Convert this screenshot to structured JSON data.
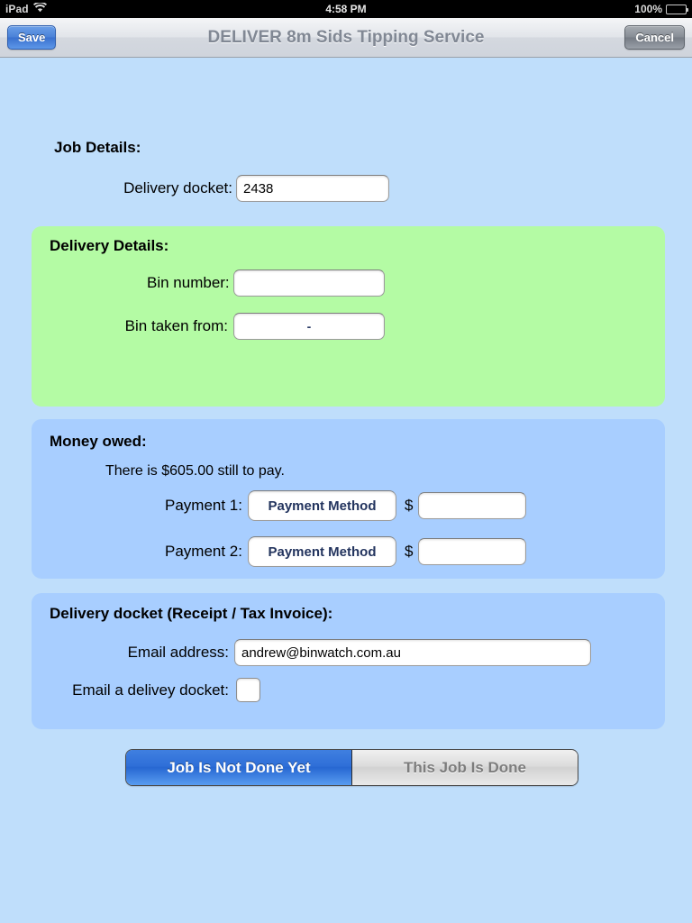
{
  "status_bar": {
    "device": "iPad",
    "wifi_icon": "wifi-icon",
    "time": "4:58 PM",
    "battery_percent": "100%",
    "battery_icon": "battery-full-icon"
  },
  "toolbar": {
    "save_label": "Save",
    "title": "DELIVER 8m Sids Tipping Service",
    "cancel_label": "Cancel"
  },
  "job_details": {
    "heading": "Job Details:",
    "delivery_docket_label": "Delivery docket:",
    "delivery_docket_value": "2438",
    "delivery_docket_placeholder": ""
  },
  "delivery_details": {
    "heading": "Delivery Details:",
    "bin_number_label": "Bin number:",
    "bin_number_value": "",
    "bin_number_placeholder": "",
    "bin_taken_from_label": "Bin taken from:",
    "bin_taken_from_value": "-"
  },
  "money_owed": {
    "heading": "Money owed:",
    "note": "There is $605.00 still to pay.",
    "amount_outstanding": "$605.00",
    "payment_1_label": "Payment 1:",
    "payment_1_method": "Payment Method",
    "payment_1_currency": "$",
    "payment_1_amount": "",
    "payment_2_label": "Payment 2:",
    "payment_2_method": "Payment Method",
    "payment_2_currency": "$",
    "payment_2_amount": ""
  },
  "delivery_docket": {
    "heading": "Delivery docket (Receipt / Tax Invoice):",
    "email_label": "Email address:",
    "email_value": "andrew@binwatch.com.au",
    "email_placeholder": "",
    "email_docket_label": "Email a delivey docket:",
    "email_docket_checked": false
  },
  "job_status": {
    "not_done_label": "Job Is Not Done Yet",
    "done_label": "This Job Is Done",
    "selected": "Job Is Not Done Yet"
  },
  "colors": {
    "page_background": "#bfdefb",
    "green_panel": "#b4fba4",
    "blue_panel": "#a8ceff",
    "accent_blue": "#2f6fd8",
    "save_button": "#4b82d8"
  }
}
